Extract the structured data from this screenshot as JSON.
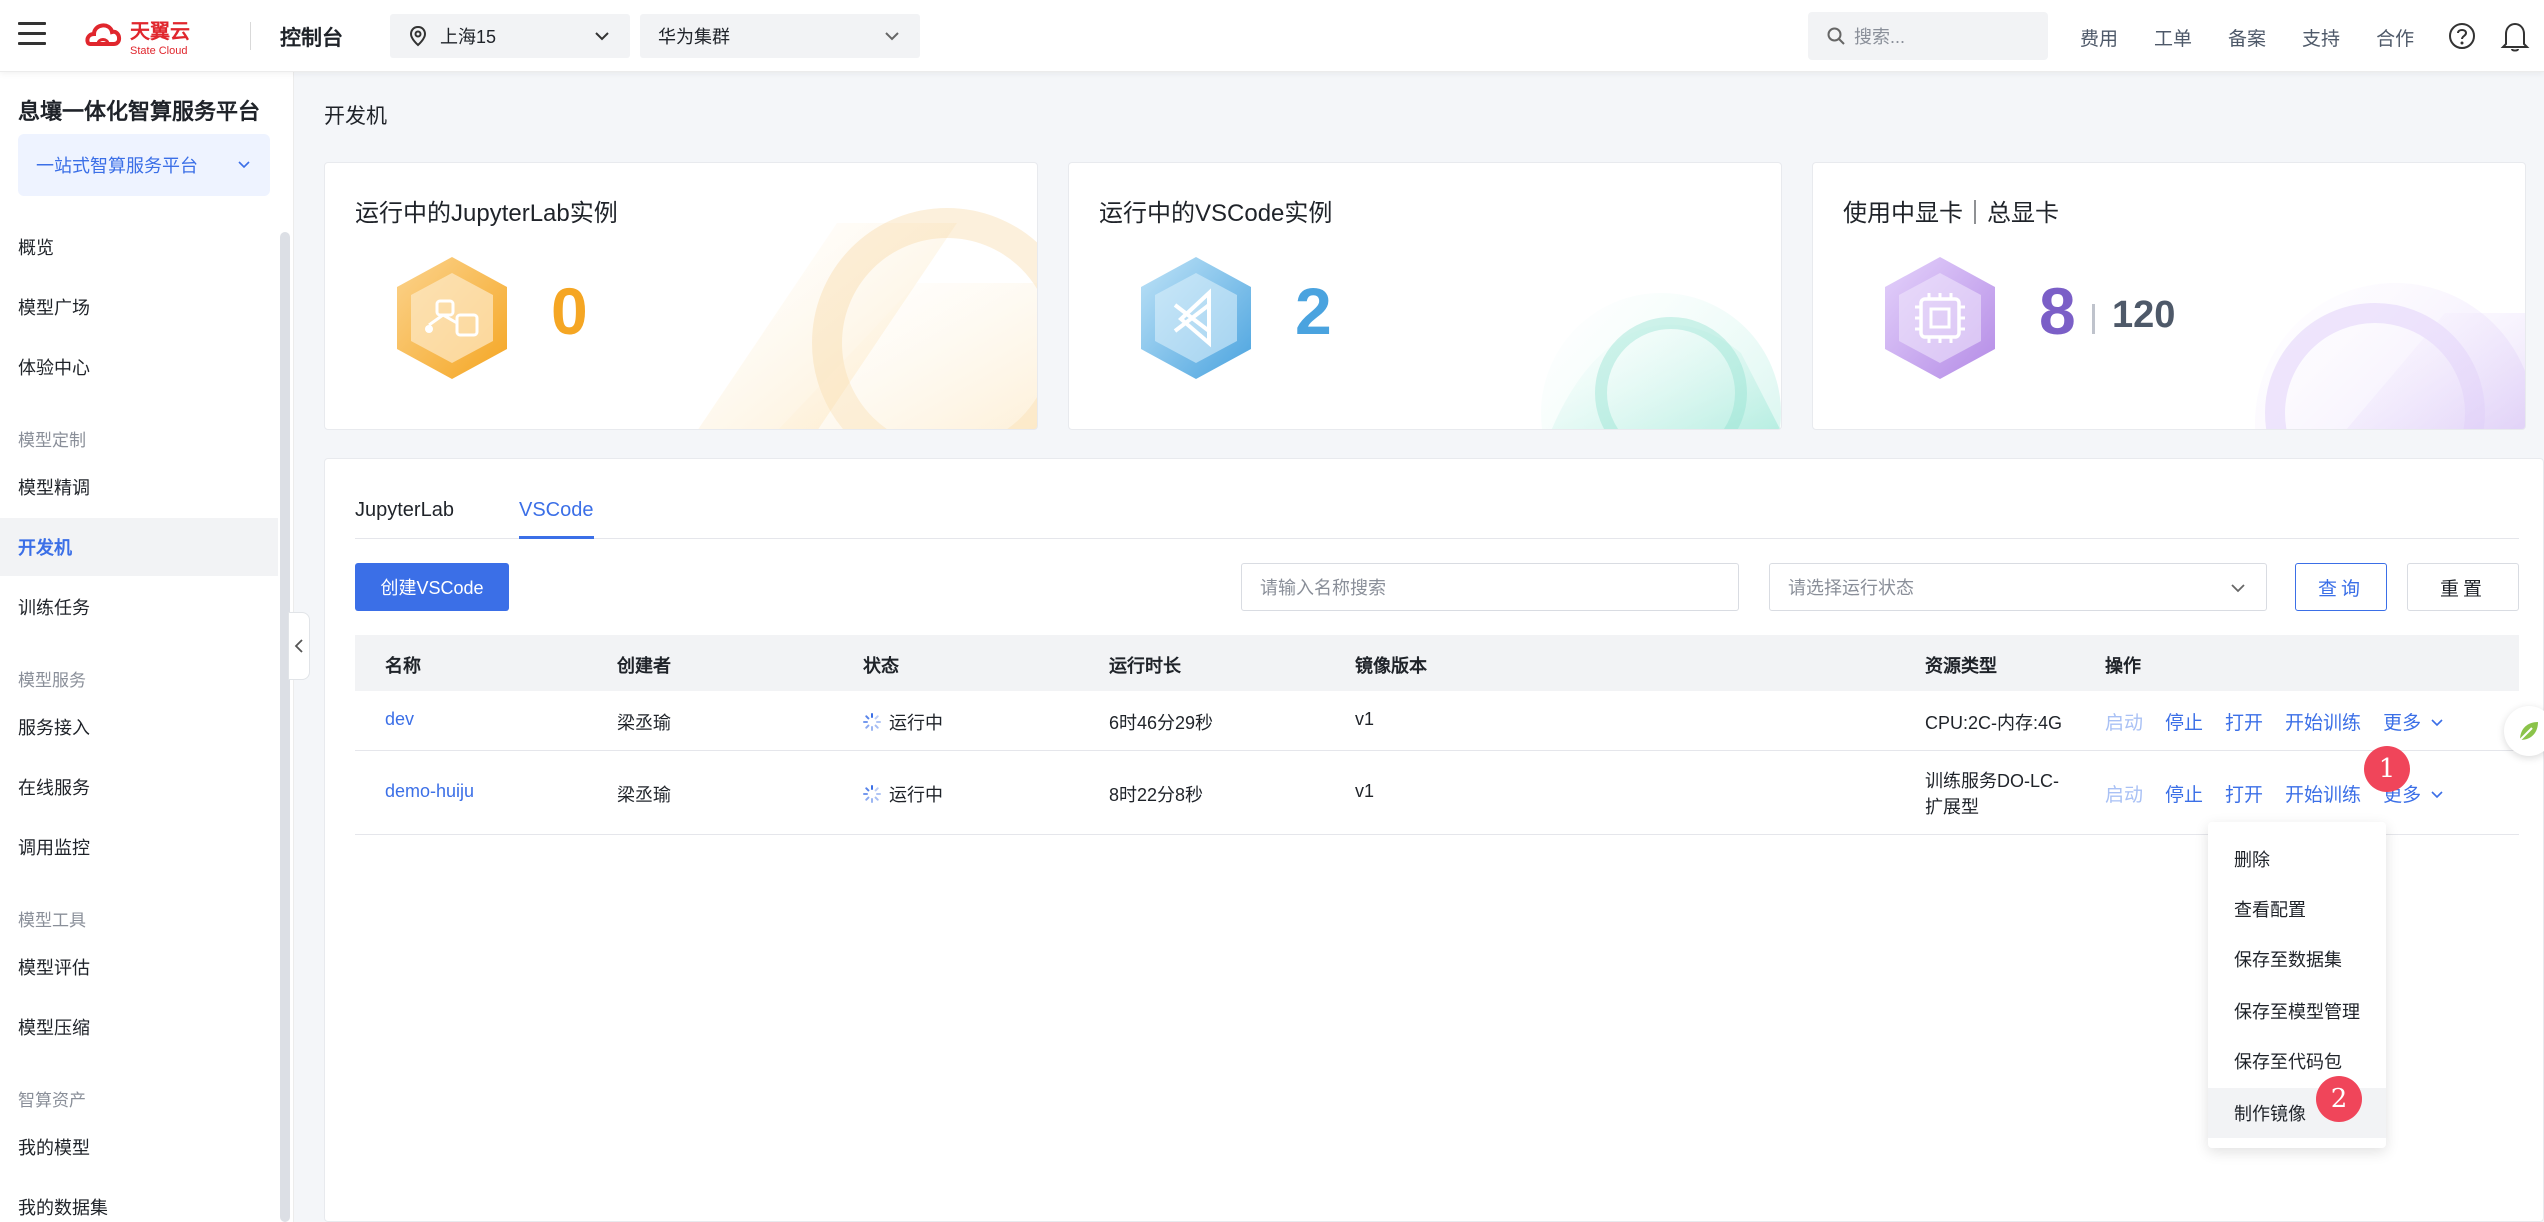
{
  "header": {
    "brand_cn": "天翼云",
    "brand_en": "State Cloud",
    "console": "控制台",
    "region": "上海15",
    "cluster": "华为集群",
    "search_placeholder": "搜索...",
    "links": [
      "费用",
      "工单",
      "备案",
      "支持",
      "合作"
    ],
    "icons": [
      "menu-icon",
      "location-pin-icon",
      "search-icon",
      "help-icon",
      "bell-icon"
    ]
  },
  "sidebar": {
    "platform_title": "息壤一体化智算服务平台",
    "platform_select": "一站式智算服务平台",
    "items": [
      {
        "label": "概览"
      },
      {
        "label": "模型广场"
      },
      {
        "label": "体验中心"
      },
      {
        "group": "模型定制"
      },
      {
        "label": "模型精调"
      },
      {
        "label": "开发机",
        "active": true
      },
      {
        "label": "训练任务"
      },
      {
        "group": "模型服务"
      },
      {
        "label": "服务接入"
      },
      {
        "label": "在线服务"
      },
      {
        "label": "调用监控"
      },
      {
        "group": "模型工具"
      },
      {
        "label": "模型评估"
      },
      {
        "label": "模型压缩"
      },
      {
        "group": "智算资产"
      },
      {
        "label": "我的模型"
      },
      {
        "label": "我的数据集"
      }
    ]
  },
  "breadcrumb": "开发机",
  "cards": [
    {
      "title": "运行中的JupyterLab实例",
      "value": "0",
      "color": "#f5a623"
    },
    {
      "title": "运行中的VSCode实例",
      "value": "2",
      "color": "#4aa3df"
    },
    {
      "title": "使用中显卡｜总显卡",
      "value": "8",
      "total": "120",
      "color": "#7b5fc7"
    }
  ],
  "tabs": [
    {
      "label": "JupyterLab"
    },
    {
      "label": "VSCode",
      "active": true
    }
  ],
  "toolbar": {
    "create_label": "创建VSCode",
    "name_placeholder": "请输入名称搜索",
    "status_placeholder": "请选择运行状态",
    "query_label": "查询",
    "reset_label": "重置"
  },
  "table": {
    "columns": [
      "名称",
      "创建者",
      "状态",
      "运行时长",
      "镜像版本",
      "资源类型",
      "操作"
    ],
    "rows": [
      {
        "name": "dev",
        "creator": "梁丞瑜",
        "status": "运行中",
        "duration": "6时46分29秒",
        "image": "v1",
        "resource": [
          "CPU:2C-内存:4G"
        ]
      },
      {
        "name": "demo-huiju",
        "creator": "梁丞瑜",
        "status": "运行中",
        "duration": "8时22分8秒",
        "image": "v1",
        "resource": [
          "训练服务DO-LC-",
          "扩展型"
        ]
      }
    ],
    "ops": {
      "start": "启动",
      "stop": "停止",
      "open": "打开",
      "train": "开始训练",
      "more": "更多"
    }
  },
  "more_menu": [
    "删除",
    "查看配置",
    "保存至数据集",
    "保存至模型管理",
    "保存至代码包",
    "制作镜像"
  ],
  "badges": [
    "1",
    "2"
  ],
  "accent": "#3b6fe7",
  "danger": "#f0455a"
}
